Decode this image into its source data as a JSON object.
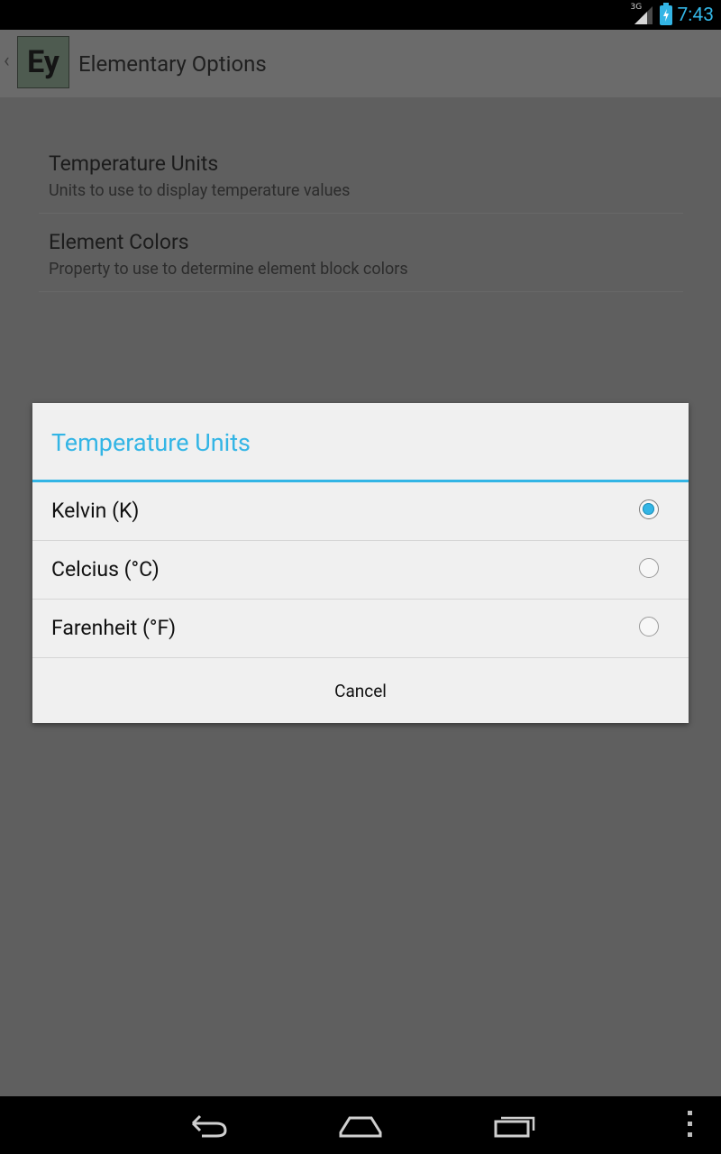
{
  "status_bar": {
    "network": "3G",
    "time": "7:43"
  },
  "action_bar": {
    "app_icon_text": "Ey",
    "title": "Elementary Options"
  },
  "preferences": [
    {
      "title": "Temperature Units",
      "summary": "Units to use to display temperature values"
    },
    {
      "title": "Element Colors",
      "summary": "Property to use to determine element block colors"
    }
  ],
  "dialog": {
    "title": "Temperature Units",
    "options": [
      {
        "label": "Kelvin (K)",
        "selected": true
      },
      {
        "label": "Celcius (°C)",
        "selected": false
      },
      {
        "label": "Farenheit (°F)",
        "selected": false
      }
    ],
    "cancel_label": "Cancel"
  },
  "colors": {
    "accent": "#33b5e5",
    "dim_background": "#5f5f5f",
    "dialog_background": "#f0f0f0"
  },
  "icons": {
    "status": [
      "signal-icon",
      "battery-charging-icon"
    ],
    "nav": [
      "back-icon",
      "home-icon",
      "recent-apps-icon",
      "overflow-menu-icon"
    ]
  }
}
